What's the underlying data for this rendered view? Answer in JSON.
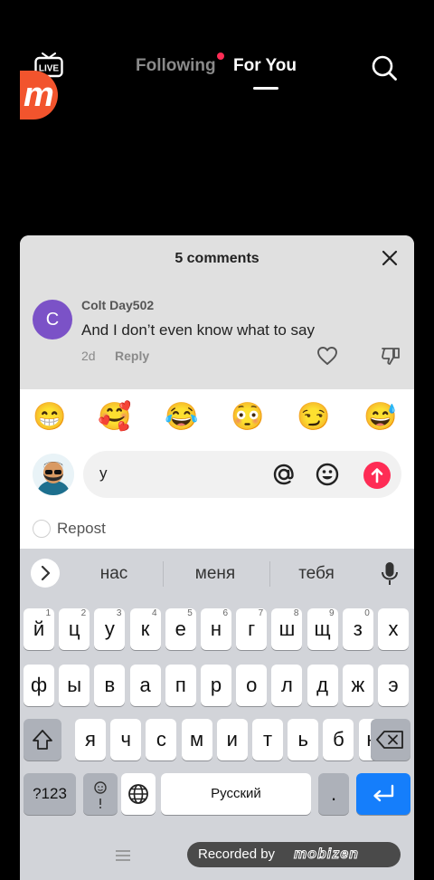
{
  "header": {
    "tabs": [
      {
        "label": "Following",
        "has_dot": true,
        "active": false
      },
      {
        "label": "For You",
        "active": true
      }
    ],
    "live_label": "LIVE",
    "accent_color": "#fe2c55"
  },
  "recorder_logo": {
    "letter": "m"
  },
  "comments": {
    "title": "5 comments",
    "items": [
      {
        "avatar_letter": "C",
        "author": "Colt Day502",
        "text": "And I don’t even know what to say",
        "time": "2d",
        "reply_label": "Reply"
      }
    ]
  },
  "emoji_bar": [
    "😁",
    "🥰",
    "😂",
    "😳",
    "😏",
    "😅"
  ],
  "composer": {
    "value": "у",
    "icons": [
      "at-icon",
      "smile-icon",
      "send-icon"
    ]
  },
  "repost": {
    "label": "Repost"
  },
  "keyboard": {
    "suggestions": [
      "нас",
      "меня",
      "тебя"
    ],
    "rows": [
      [
        {
          "k": "й",
          "n": "1"
        },
        {
          "k": "ц",
          "n": "2"
        },
        {
          "k": "у",
          "n": "3"
        },
        {
          "k": "к",
          "n": "4"
        },
        {
          "k": "е",
          "n": "5"
        },
        {
          "k": "н",
          "n": "6"
        },
        {
          "k": "г",
          "n": "7"
        },
        {
          "k": "ш",
          "n": "8"
        },
        {
          "k": "щ",
          "n": "9"
        },
        {
          "k": "з",
          "n": "0"
        },
        {
          "k": "х",
          "n": ""
        }
      ],
      [
        {
          "k": "ф",
          "n": ""
        },
        {
          "k": "ы",
          "n": ""
        },
        {
          "k": "в",
          "n": ""
        },
        {
          "k": "а",
          "n": ""
        },
        {
          "k": "п",
          "n": ""
        },
        {
          "k": "р",
          "n": ""
        },
        {
          "k": "о",
          "n": ""
        },
        {
          "k": "л",
          "n": ""
        },
        {
          "k": "д",
          "n": ""
        },
        {
          "k": "ж",
          "n": ""
        },
        {
          "k": "э",
          "n": ""
        }
      ],
      [
        {
          "k": "я",
          "n": ""
        },
        {
          "k": "ч",
          "n": ""
        },
        {
          "k": "с",
          "n": ""
        },
        {
          "k": "м",
          "n": ""
        },
        {
          "k": "и",
          "n": ""
        },
        {
          "k": "т",
          "n": ""
        },
        {
          "k": "ь",
          "n": ""
        },
        {
          "k": "б",
          "n": ""
        },
        {
          "k": "ю",
          "n": ""
        }
      ]
    ],
    "mode_label": "?123",
    "space_label": "Русский",
    "dot_label": "."
  },
  "watermark": {
    "text": "Recorded by",
    "logo_text": "mobizen"
  }
}
